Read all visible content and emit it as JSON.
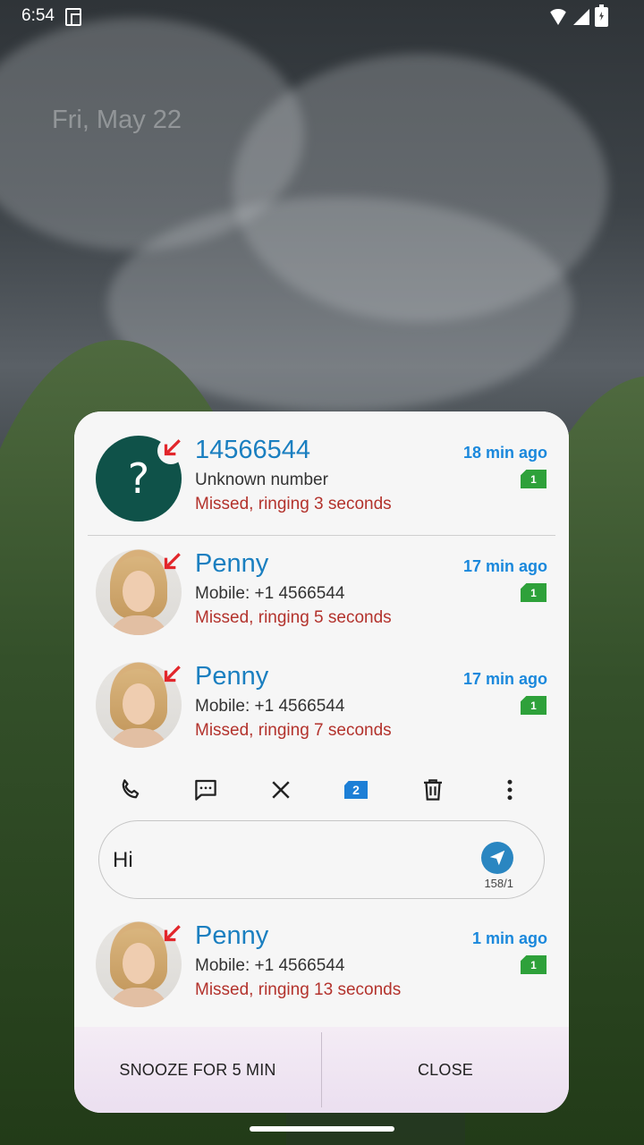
{
  "status_bar": {
    "time": "6:54"
  },
  "lock_screen": {
    "date": "Fri, May 22"
  },
  "calls": [
    {
      "name": "14566544",
      "subtitle": "Unknown number",
      "status": "Missed, ringing 3 seconds",
      "time": "18 min ago",
      "sim": "1",
      "avatar": "?"
    },
    {
      "name": "Penny",
      "subtitle": "Mobile: +1 4566544",
      "status": "Missed, ringing 5 seconds",
      "time": "17 min ago",
      "sim": "1"
    },
    {
      "name": "Penny",
      "subtitle": "Mobile: +1 4566544",
      "status": "Missed, ringing 7 seconds",
      "time": "17 min ago",
      "sim": "1"
    },
    {
      "name": "Penny",
      "subtitle": "Mobile: +1 4566544",
      "status": "Missed, ringing 13 seconds",
      "time": "1 min ago",
      "sim": "1"
    }
  ],
  "actions": {
    "sim_badge": "2"
  },
  "reply": {
    "text": "Hi",
    "char_count": "158/1"
  },
  "footer": {
    "snooze_label": "SNOOZE FOR 5 MIN",
    "close_label": "CLOSE"
  },
  "colors": {
    "name": "#1a7fc0",
    "missed": "#b3322c",
    "time": "#1a88dc",
    "sim": "#2ea13a",
    "accent": "#1c7fd6"
  }
}
